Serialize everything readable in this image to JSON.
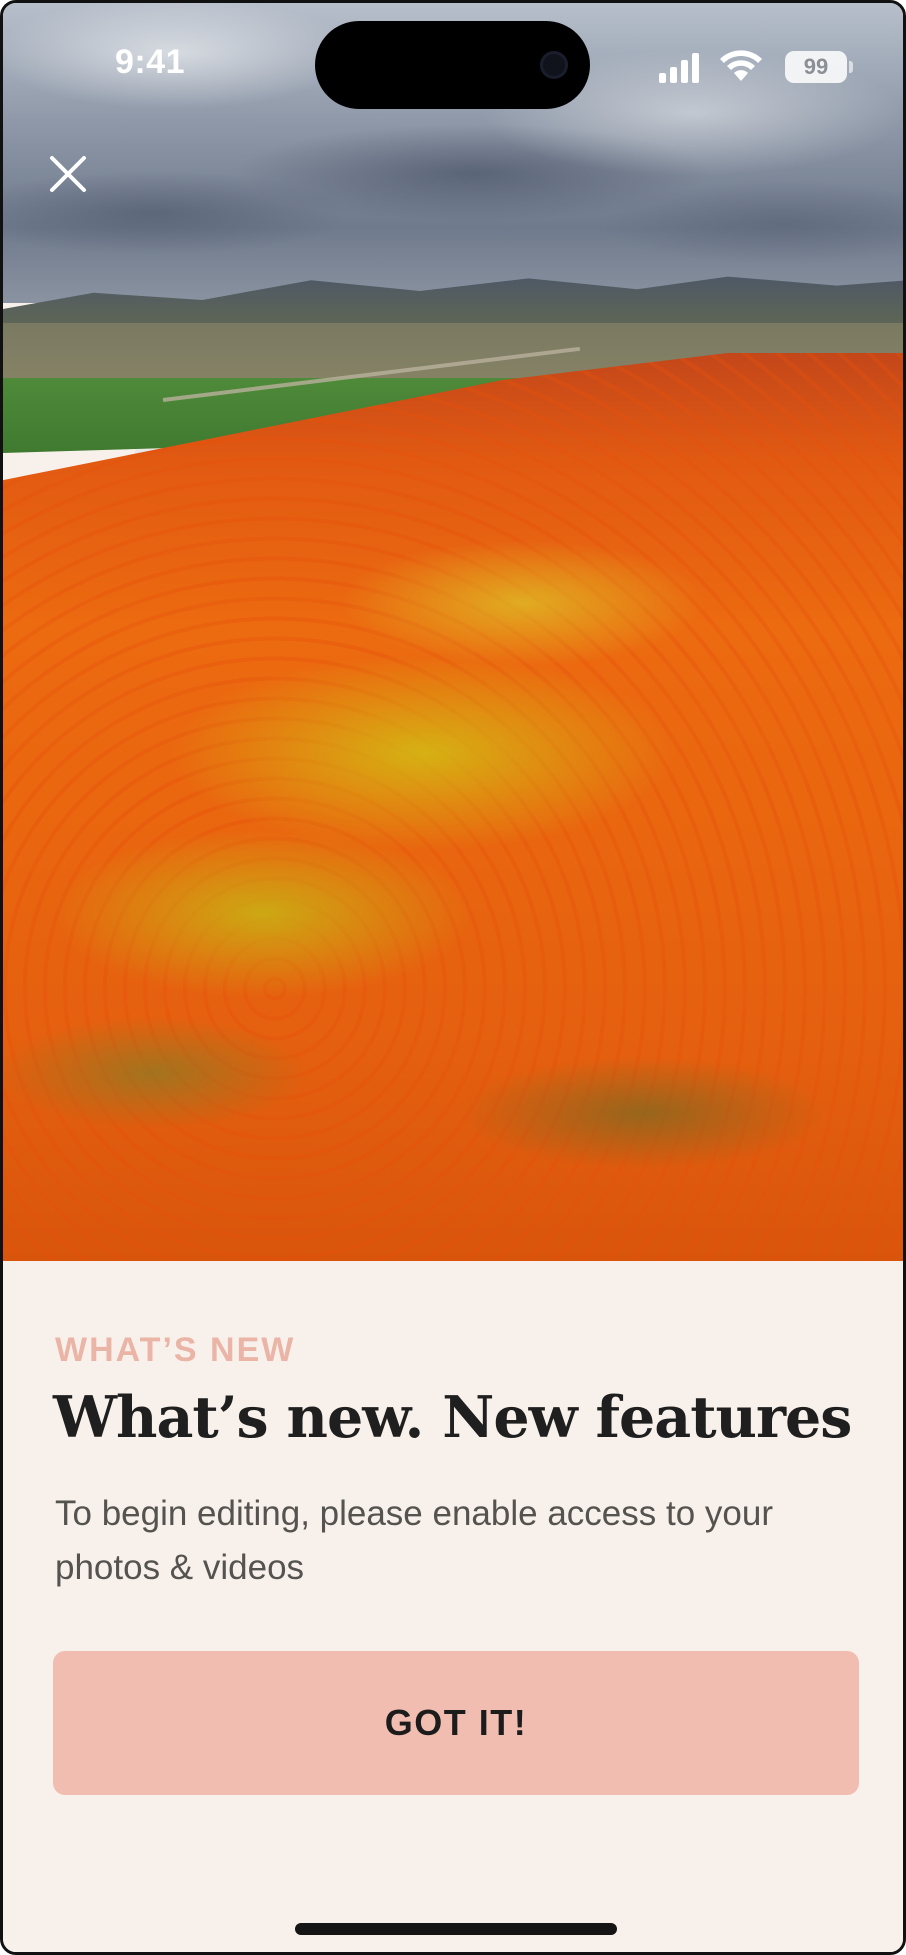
{
  "status_bar": {
    "time": "9:41",
    "battery_level": "99",
    "icons": [
      "cellular-signal-icon",
      "wifi-icon",
      "battery-icon"
    ]
  },
  "hero": {
    "icons": [
      "close-icon"
    ]
  },
  "content": {
    "eyebrow": "WHAT’S NEW",
    "title": "What’s new. New features",
    "subtitle": "To begin editing, please enable access to your photos & videos",
    "button_label": "GOT IT!"
  },
  "colors": {
    "background": "#F8F1EB",
    "eyebrow": "#EAB5A6",
    "button": "#F2BDB1",
    "title": "#1F1F1F",
    "subtitle": "#555350"
  }
}
